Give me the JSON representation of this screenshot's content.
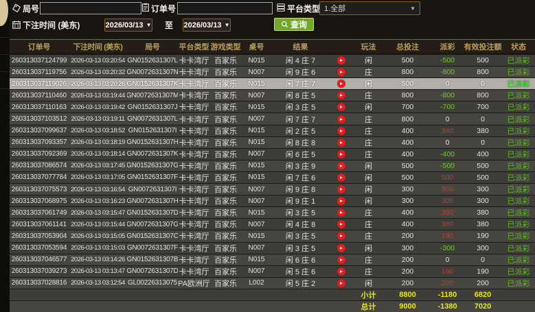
{
  "toolbar": {
    "round_label": "局号",
    "order_label": "订单号",
    "platform_label": "平台类型",
    "platform_value": "1.全部",
    "bet_time_label": "下注时间 (美东)",
    "date_from": "2026/03/13",
    "to_label": "至",
    "date_to": "2026/03/13",
    "query_label": "查询",
    "round_input_value": "",
    "order_input_value": ""
  },
  "table": {
    "headers": [
      "订单号",
      "下注时间 (美东)",
      "局号",
      "平台类型",
      "游戏类型",
      "桌号",
      "结果",
      "",
      "玩法",
      "总投注",
      "派彩",
      "有效投注额",
      "状态"
    ],
    "rows": [
      {
        "order": "260313037124799",
        "time": "2026-03-13 03:20:54",
        "round": "GN0152631307L",
        "platform": "卡卡湾厅",
        "game": "百家乐",
        "table_no": "N015",
        "result": "闲 4 庄 7",
        "play": "闲",
        "bet": "500",
        "payout": "-500",
        "valid": "500",
        "status": "已派彩",
        "highlight": false
      },
      {
        "order": "260313037119756",
        "time": "2026-03-13 03:20:32",
        "round": "GN0072631307N",
        "platform": "卡卡湾厅",
        "game": "百家乐",
        "table_no": "N007",
        "result": "闲 9 庄 6",
        "play": "庄",
        "bet": "800",
        "payout": "-800",
        "valid": "800",
        "status": "已派彩",
        "highlight": false
      },
      {
        "order": "260313037119026",
        "time": "2026-03-13 03:20:26",
        "round": "GN0152631307K",
        "platform": "卡卡湾厅",
        "game": "百家乐",
        "table_no": "N015",
        "result": "闲 7 庄 7",
        "play": "闲",
        "bet": "500",
        "payout": "0",
        "valid": "0",
        "status": "已派彩",
        "highlight": true
      },
      {
        "order": "260313037110460",
        "time": "2026-03-13 03:19:44",
        "round": "GN0072631307M",
        "platform": "卡卡湾厅",
        "game": "百家乐",
        "table_no": "N007",
        "result": "闲 8 庄 5",
        "play": "庄",
        "bet": "800",
        "payout": "-800",
        "valid": "800",
        "status": "已派彩",
        "highlight": false
      },
      {
        "order": "260313037110163",
        "time": "2026-03-13 03:19:42",
        "round": "GN0152631307J",
        "platform": "卡卡湾厅",
        "game": "百家乐",
        "table_no": "N015",
        "result": "闲 3 庄 5",
        "play": "闲",
        "bet": "700",
        "payout": "-700",
        "valid": "700",
        "status": "已派彩",
        "highlight": false
      },
      {
        "order": "260313037103512",
        "time": "2026-03-13 03:19:11",
        "round": "GN0072631307L",
        "platform": "卡卡湾厅",
        "game": "百家乐",
        "table_no": "N007",
        "result": "闲 7 庄 7",
        "play": "庄",
        "bet": "800",
        "payout": "0",
        "valid": "0",
        "status": "已派彩",
        "highlight": false
      },
      {
        "order": "260313037099637",
        "time": "2026-03-13 03:18:52",
        "round": "GN0152631307I",
        "platform": "卡卡湾厅",
        "game": "百家乐",
        "table_no": "N015",
        "result": "闲 2 庄 5",
        "play": "庄",
        "bet": "400",
        "payout": "380",
        "valid": "380",
        "status": "已派彩",
        "highlight": false
      },
      {
        "order": "260313037093357",
        "time": "2026-03-13 03:18:19",
        "round": "GN0152631307H",
        "platform": "卡卡湾厅",
        "game": "百家乐",
        "table_no": "N015",
        "result": "闲 8 庄 8",
        "play": "庄",
        "bet": "400",
        "payout": "0",
        "valid": "0",
        "status": "已派彩",
        "highlight": false
      },
      {
        "order": "260313037092369",
        "time": "2026-03-13 03:18:14",
        "round": "GN0072631307K",
        "platform": "卡卡湾厅",
        "game": "百家乐",
        "table_no": "N007",
        "result": "闲 6 庄 5",
        "play": "庄",
        "bet": "400",
        "payout": "-400",
        "valid": "400",
        "status": "已派彩",
        "highlight": false
      },
      {
        "order": "260313037086574",
        "time": "2026-03-13 03:17:45",
        "round": "GN0152631307G",
        "platform": "卡卡湾厅",
        "game": "百家乐",
        "table_no": "N015",
        "result": "闲 3 庄 9",
        "play": "闲",
        "bet": "500",
        "payout": "-500",
        "valid": "500",
        "status": "已派彩",
        "highlight": false
      },
      {
        "order": "260313037077784",
        "time": "2026-03-13 03:17:05",
        "round": "GN0152631307F",
        "platform": "卡卡湾厅",
        "game": "百家乐",
        "table_no": "N015",
        "result": "闲 7 庄 6",
        "play": "闲",
        "bet": "500",
        "payout": "500",
        "valid": "500",
        "status": "已派彩",
        "highlight": false
      },
      {
        "order": "260313037075573",
        "time": "2026-03-13 03:16:54",
        "round": "GN0072631307I",
        "platform": "卡卡湾厅",
        "game": "百家乐",
        "table_no": "N007",
        "result": "闲 9 庄 8",
        "play": "闲",
        "bet": "300",
        "payout": "300",
        "valid": "300",
        "status": "已派彩",
        "highlight": false
      },
      {
        "order": "260313037068975",
        "time": "2026-03-13 03:16:23",
        "round": "GN0072631307H",
        "platform": "卡卡湾厅",
        "game": "百家乐",
        "table_no": "N007",
        "result": "闲 9 庄 1",
        "play": "闲",
        "bet": "300",
        "payout": "300",
        "valid": "300",
        "status": "已派彩",
        "highlight": false
      },
      {
        "order": "260313037061749",
        "time": "2026-03-13 03:15:47",
        "round": "GN0152631307D",
        "platform": "卡卡湾厅",
        "game": "百家乐",
        "table_no": "N015",
        "result": "闲 3 庄 5",
        "play": "庄",
        "bet": "400",
        "payout": "380",
        "valid": "380",
        "status": "已派彩",
        "highlight": false
      },
      {
        "order": "260313037061141",
        "time": "2026-03-13 03:15:44",
        "round": "GN0072631307G",
        "platform": "卡卡湾厅",
        "game": "百家乐",
        "table_no": "N007",
        "result": "闲 4 庄 8",
        "play": "庄",
        "bet": "400",
        "payout": "380",
        "valid": "380",
        "status": "已派彩",
        "highlight": false
      },
      {
        "order": "260313037053904",
        "time": "2026-03-13 03:15:05",
        "round": "GN0152631307C",
        "platform": "卡卡湾厅",
        "game": "百家乐",
        "table_no": "N015",
        "result": "闲 3 庄 5",
        "play": "庄",
        "bet": "200",
        "payout": "190",
        "valid": "190",
        "status": "已派彩",
        "highlight": false
      },
      {
        "order": "260313037053594",
        "time": "2026-03-13 03:15:03",
        "round": "GN0072631307F",
        "platform": "卡卡湾厅",
        "game": "百家乐",
        "table_no": "N007",
        "result": "闲 3 庄 5",
        "play": "闲",
        "bet": "300",
        "payout": "-300",
        "valid": "300",
        "status": "已派彩",
        "highlight": false
      },
      {
        "order": "260313037046577",
        "time": "2026-03-13 03:14:26",
        "round": "GN0152631307B",
        "platform": "卡卡湾厅",
        "game": "百家乐",
        "table_no": "N015",
        "result": "闲 6 庄 6",
        "play": "庄",
        "bet": "200",
        "payout": "0",
        "valid": "0",
        "status": "已派彩",
        "highlight": false
      },
      {
        "order": "260313037039273",
        "time": "2026-03-13 03:13:47",
        "round": "GN0072631307D",
        "platform": "卡卡湾厅",
        "game": "百家乐",
        "table_no": "N007",
        "result": "闲 5 庄 6",
        "play": "庄",
        "bet": "200",
        "payout": "190",
        "valid": "190",
        "status": "已派彩",
        "highlight": false
      },
      {
        "order": "260313037028816",
        "time": "2026-03-13 03:12:54",
        "round": "GL00226313075",
        "platform": "PA欧洲厅",
        "game": "百家乐",
        "table_no": "L002",
        "result": "闲 5 庄 2",
        "play": "闲",
        "bet": "200",
        "payout": "200",
        "valid": "200",
        "status": "已派彩",
        "highlight": false
      }
    ],
    "summary": [
      {
        "label": "小计",
        "bet": "8800",
        "payout": "-1180",
        "valid": "6820"
      },
      {
        "label": "总计",
        "bet": "9000",
        "payout": "-1380",
        "valid": "7020"
      }
    ]
  },
  "colors": {
    "accent_button_green": "#6fa82b",
    "payout_positive_red": "#bb3f2c",
    "payout_negative_green": "#6ad41d",
    "status_paid_green": "#5abf1e",
    "summary_yellow": "#e6e622",
    "header_gold": "#b89d62",
    "picker_border_brown": "#92601f",
    "highlight_row_gray": "#b3b0ab",
    "play_button_red": "#e21f1f"
  }
}
